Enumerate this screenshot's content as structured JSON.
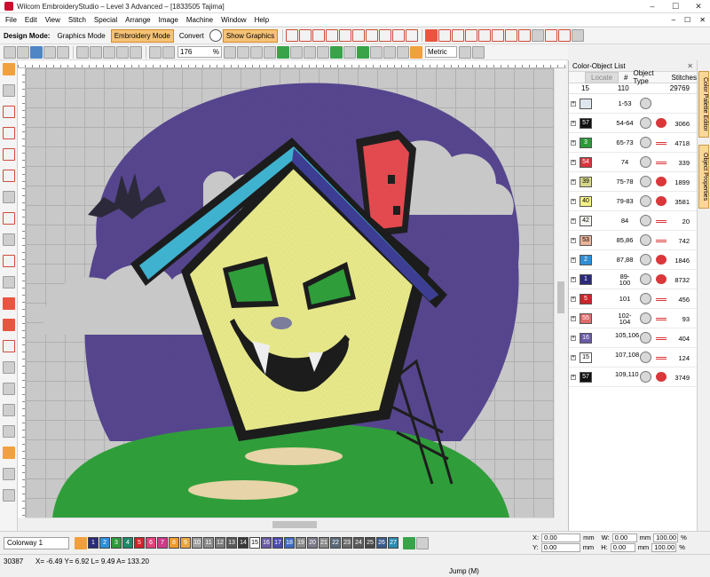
{
  "window": {
    "title": "Wilcom EmbroideryStudio – Level 3 Advanced – [1833505 Tajima]",
    "min": "–",
    "max": "☐",
    "close": "✕"
  },
  "menu": [
    "File",
    "Edit",
    "View",
    "Stitch",
    "Special",
    "Arrange",
    "Image",
    "Machine",
    "Window",
    "Help"
  ],
  "toolbar1": {
    "design_mode_label": "Design Mode:",
    "graphics_mode": "Graphics Mode",
    "embroidery_mode": "Embroidery Mode",
    "convert": "Convert",
    "show_graphics": "Show Graphics"
  },
  "toolbar2": {
    "zoom": "176",
    "zoom_unit": "%",
    "units": "Metric"
  },
  "docker": {
    "title": "Color-Object List",
    "columns": {
      "locate": "Locate",
      "num": "#",
      "object_type": "Object Type",
      "stitches": "Stitches"
    },
    "summary": {
      "count": "15",
      "objects": "110",
      "stitches": "29769"
    },
    "rows": [
      {
        "swatch": "",
        "swatch_color": "#dfe6ee",
        "text_color": "#000",
        "range": "1-53",
        "stitches": "",
        "type2": "none"
      },
      {
        "swatch": "57",
        "swatch_color": "#111111",
        "text_color": "#fff",
        "range": "54-64",
        "stitches": "3066",
        "type2": "fill"
      },
      {
        "swatch": "3",
        "swatch_color": "#2d9a3a",
        "text_color": "#fff",
        "range": "65-73",
        "stitches": "4718",
        "type2": "run"
      },
      {
        "swatch": "54",
        "swatch_color": "#d4363c",
        "text_color": "#fff",
        "range": "74",
        "stitches": "339",
        "type2": "run"
      },
      {
        "swatch": "39",
        "swatch_color": "#d6d68a",
        "text_color": "#000",
        "range": "75-78",
        "stitches": "1899",
        "type2": "fill"
      },
      {
        "swatch": "40",
        "swatch_color": "#f3f186",
        "text_color": "#000",
        "range": "79-83",
        "stitches": "3581",
        "type2": "fill"
      },
      {
        "swatch": "42",
        "swatch_color": "#f4f4f0",
        "text_color": "#000",
        "range": "84",
        "stitches": "20",
        "type2": "run"
      },
      {
        "swatch": "53",
        "swatch_color": "#e9b39a",
        "text_color": "#000",
        "range": "85,86",
        "stitches": "742",
        "type2": "run"
      },
      {
        "swatch": "2",
        "swatch_color": "#2d8fd6",
        "text_color": "#fff",
        "range": "87,88",
        "stitches": "1846",
        "type2": "fill"
      },
      {
        "swatch": "1",
        "swatch_color": "#2b2b7a",
        "text_color": "#fff",
        "range": "89-100",
        "stitches": "8732",
        "type2": "fill"
      },
      {
        "swatch": "5",
        "swatch_color": "#d2232a",
        "text_color": "#fff",
        "range": "101",
        "stitches": "456",
        "type2": "run"
      },
      {
        "swatch": "55",
        "swatch_color": "#e06a6a",
        "text_color": "#fff",
        "range": "102-104",
        "stitches": "93",
        "type2": "run"
      },
      {
        "swatch": "16",
        "swatch_color": "#6a5aa6",
        "text_color": "#fff",
        "range": "105,106",
        "stitches": "404",
        "type2": "run"
      },
      {
        "swatch": "15",
        "swatch_color": "#ffffff",
        "text_color": "#000",
        "range": "107,108",
        "stitches": "124",
        "type2": "run"
      },
      {
        "swatch": "57",
        "swatch_color": "#111111",
        "text_color": "#fff",
        "range": "109,110",
        "stitches": "3749",
        "type2": "fill"
      }
    ]
  },
  "side_tabs": {
    "color_palette": "Color Palette Editor",
    "object_properties": "Object Properties"
  },
  "colorway": "Colorway 1",
  "palette": [
    {
      "n": "1",
      "c": "#2b2b7a"
    },
    {
      "n": "2",
      "c": "#2d8fd6"
    },
    {
      "n": "3",
      "c": "#2d9a3a"
    },
    {
      "n": "4",
      "c": "#1f8a6a"
    },
    {
      "n": "5",
      "c": "#d2232a"
    },
    {
      "n": "6",
      "c": "#e3427a"
    },
    {
      "n": "7",
      "c": "#d13a8a"
    },
    {
      "n": "8",
      "c": "#f09b2a"
    },
    {
      "n": "9",
      "c": "#e8a646"
    },
    {
      "n": "10",
      "c": "#a0a0a0"
    },
    {
      "n": "11",
      "c": "#8d8d8d"
    },
    {
      "n": "12",
      "c": "#7a7a7a"
    },
    {
      "n": "13",
      "c": "#5a5a5a"
    },
    {
      "n": "14",
      "c": "#3a3a3a"
    },
    {
      "n": "15",
      "c": "#ffffff"
    },
    {
      "n": "16",
      "c": "#6a5aa6"
    },
    {
      "n": "17",
      "c": "#4a4ab0"
    },
    {
      "n": "18",
      "c": "#3f6bbf"
    },
    {
      "n": "19",
      "c": "#8a8a8a"
    },
    {
      "n": "20",
      "c": "#7a7a8a"
    },
    {
      "n": "21",
      "c": "#8a8a8a"
    },
    {
      "n": "22",
      "c": "#5a6a7a"
    },
    {
      "n": "23",
      "c": "#6a6a6a"
    },
    {
      "n": "24",
      "c": "#5a5a5a"
    },
    {
      "n": "25",
      "c": "#4a4a4a"
    },
    {
      "n": "26",
      "c": "#3a5a8a"
    },
    {
      "n": "27",
      "c": "#2a8ab0"
    }
  ],
  "coords": {
    "x_label": "X:",
    "x": "0.00",
    "y_label": "Y:",
    "y": "0.00",
    "unit": "mm",
    "w_label": "W:",
    "w": "0.00",
    "h_label": "H:",
    "h": "0.00",
    "pct_w": "100.00",
    "pct_h": "100.00",
    "pct": "%"
  },
  "status": {
    "stitch": "30387",
    "coords": "X=  -6.49 Y=   6.92 L=   9.49 A= 133.20",
    "mode": "Jump (M)"
  }
}
